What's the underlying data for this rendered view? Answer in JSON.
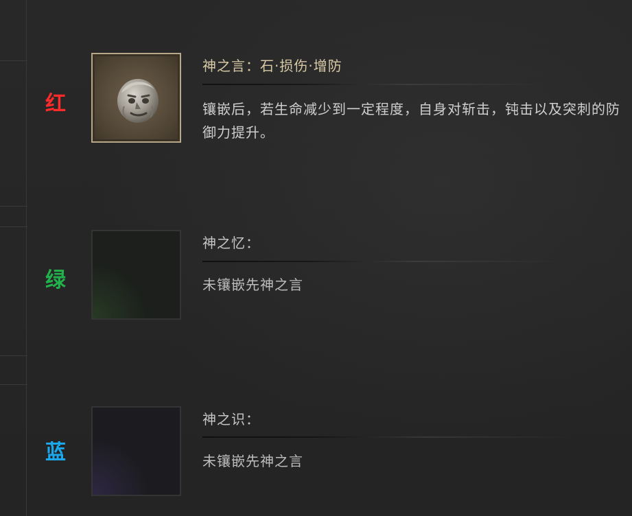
{
  "slots": [
    {
      "color_label": "红",
      "color_hex": "#ff2a2a",
      "state": "filled",
      "icon": "stone-head-icon",
      "title": "神之言：石·损伤·增防",
      "description": "镶嵌后，若生命减少到一定程度，自身对斩击，钝击以及突刺的防御力提升。"
    },
    {
      "color_label": "绿",
      "color_hex": "#22b24c",
      "state": "empty",
      "title": "神之忆：",
      "description": "未镶嵌先神之言"
    },
    {
      "color_label": "蓝",
      "color_hex": "#1aa7ec",
      "state": "empty",
      "title": "神之识：",
      "description": "未镶嵌先神之言"
    }
  ]
}
